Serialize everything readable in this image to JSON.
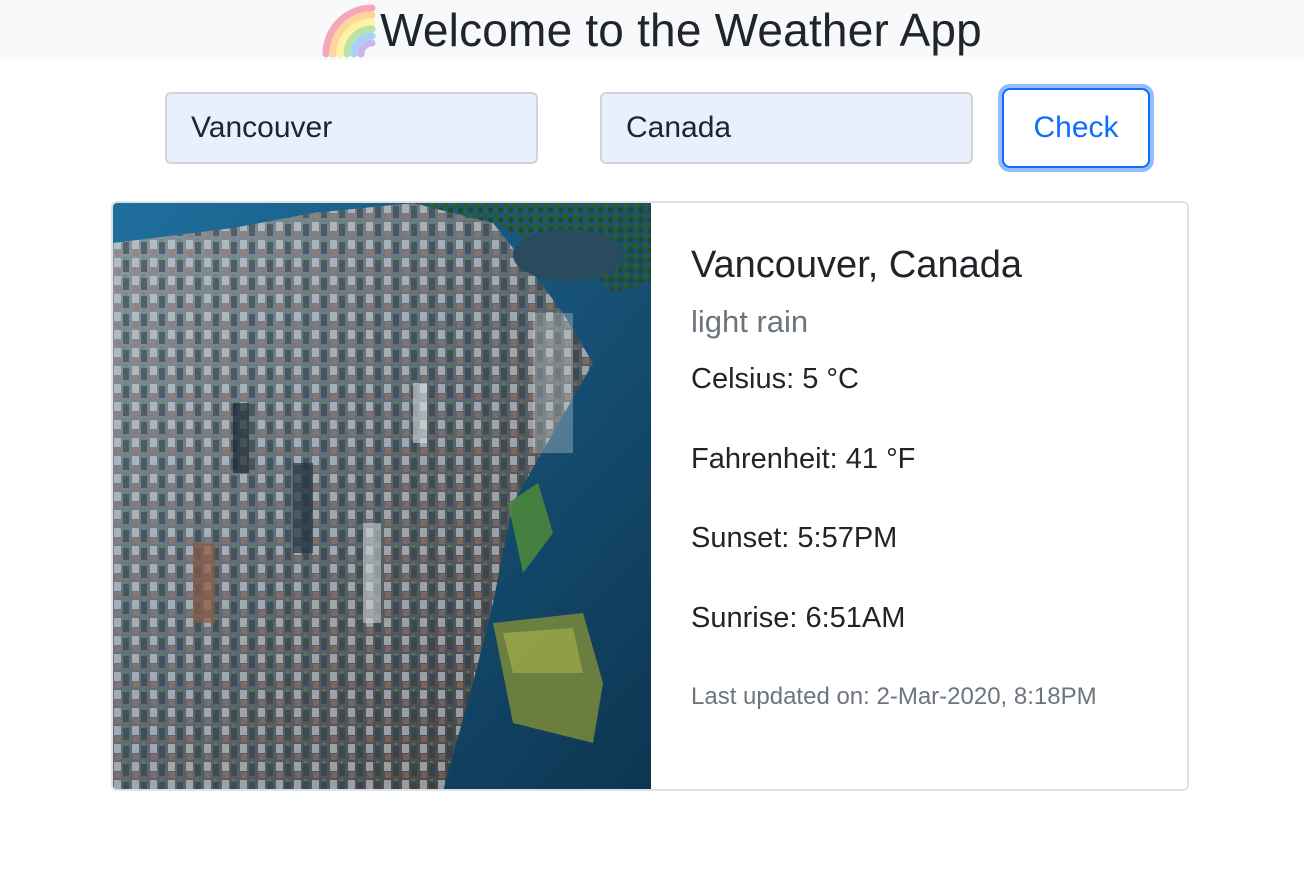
{
  "header": {
    "icon": "rainbow-icon",
    "title": "Welcome to the Weather App"
  },
  "form": {
    "city_value": "Vancouver",
    "country_value": "Canada",
    "check_label": "Check"
  },
  "card": {
    "image": "vancouver-aerial-photo",
    "location": "Vancouver, Canada",
    "description": "light rain",
    "celsius": "Celsius: 5 °C",
    "fahrenheit": "Fahrenheit: 41 °F",
    "sunset": "Sunset: 5:57PM",
    "sunrise": "Sunrise: 6:51AM",
    "last_updated": "Last updated on: 2-Mar-2020, 8:18PM"
  },
  "colors": {
    "accent": "#0d6efd",
    "header_bg": "#f8f9fa",
    "input_bg": "#e8f0fe",
    "muted_text": "#6c757d"
  }
}
